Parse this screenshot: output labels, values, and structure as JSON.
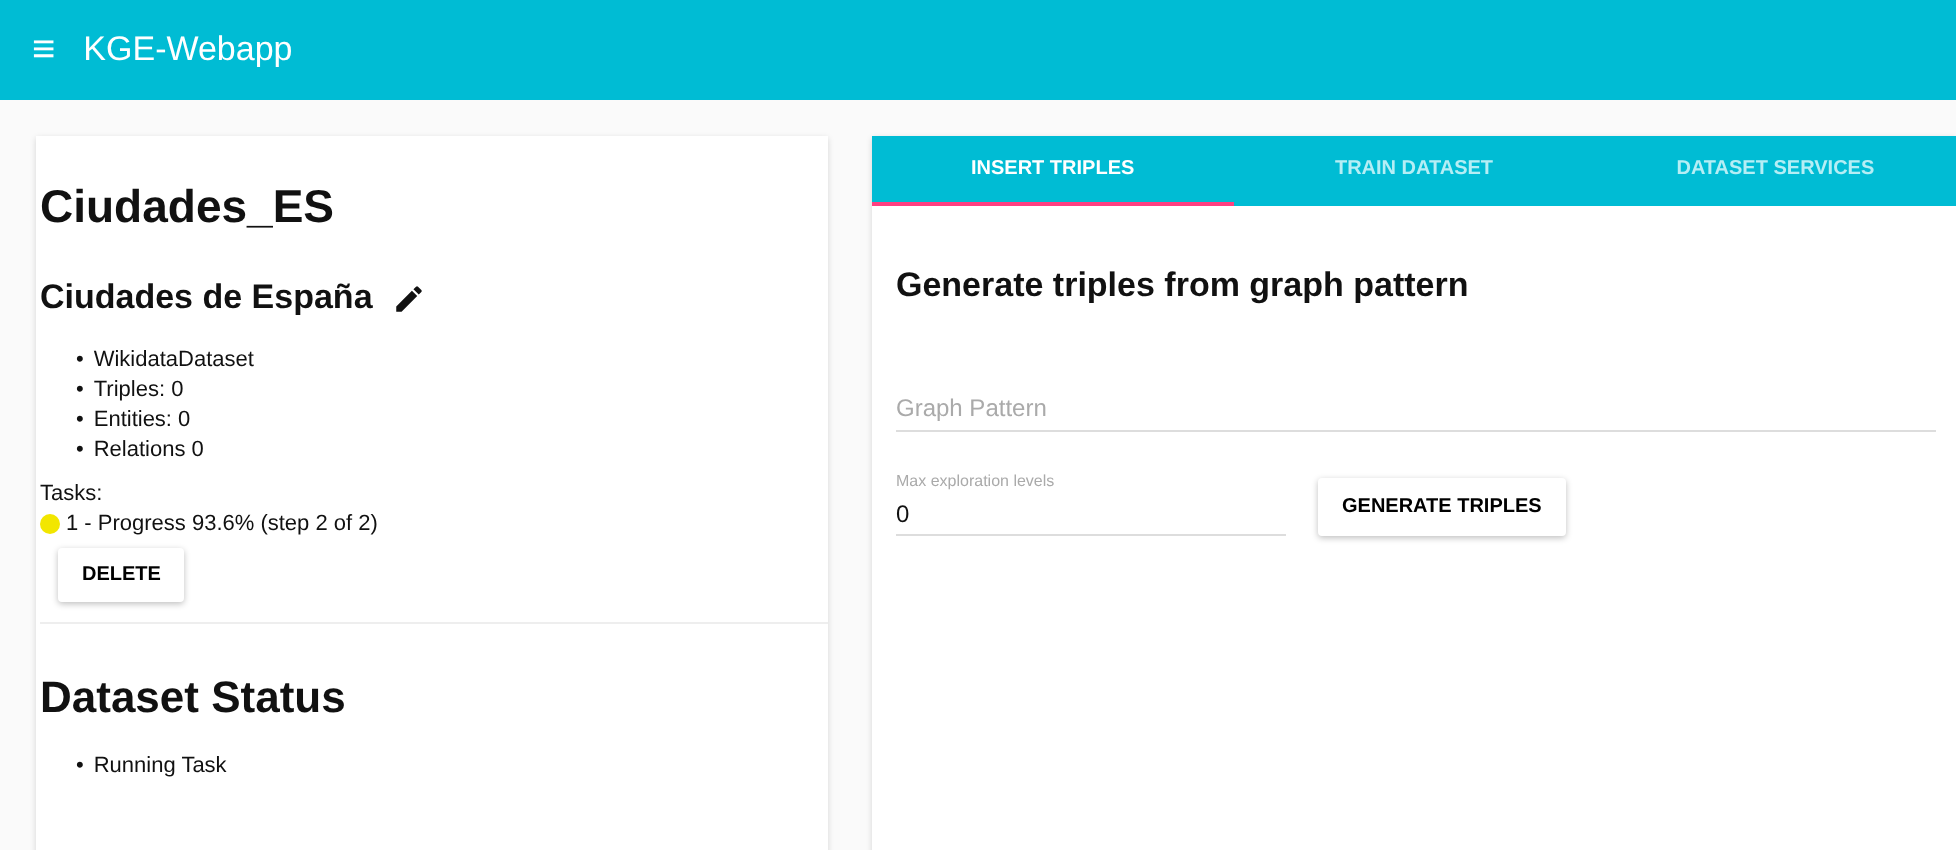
{
  "app_bar": {
    "menu_icon": "≡",
    "title": "KGE-Webapp"
  },
  "dataset": {
    "name": "Ciudades_ES",
    "description": "Ciudades de España",
    "bullet": "•",
    "info": [
      "WikidataDataset",
      "Triples: 0",
      "Entities: 0",
      "Relations 0"
    ],
    "tasks_label": "Tasks:",
    "tasks": [
      {
        "label": "1 - Progress 93.6% (step 2 of 2)",
        "color": "#f2e600"
      }
    ],
    "delete_button": "DELETE"
  },
  "status": {
    "title": "Dataset Status",
    "bullet": "•",
    "items": [
      "Running Task"
    ]
  },
  "tabs": [
    {
      "label": "INSERT TRIPLES",
      "selected": true
    },
    {
      "label": "TRAIN DATASET",
      "selected": false
    },
    {
      "label": "DATASET SERVICES",
      "selected": false
    }
  ],
  "form": {
    "title": "Generate triples from graph pattern",
    "graph_pattern": {
      "placeholder": "Graph Pattern"
    },
    "levels": {
      "label": "Max exploration levels",
      "value": "0"
    },
    "button": "GENERATE TRIPLES"
  }
}
